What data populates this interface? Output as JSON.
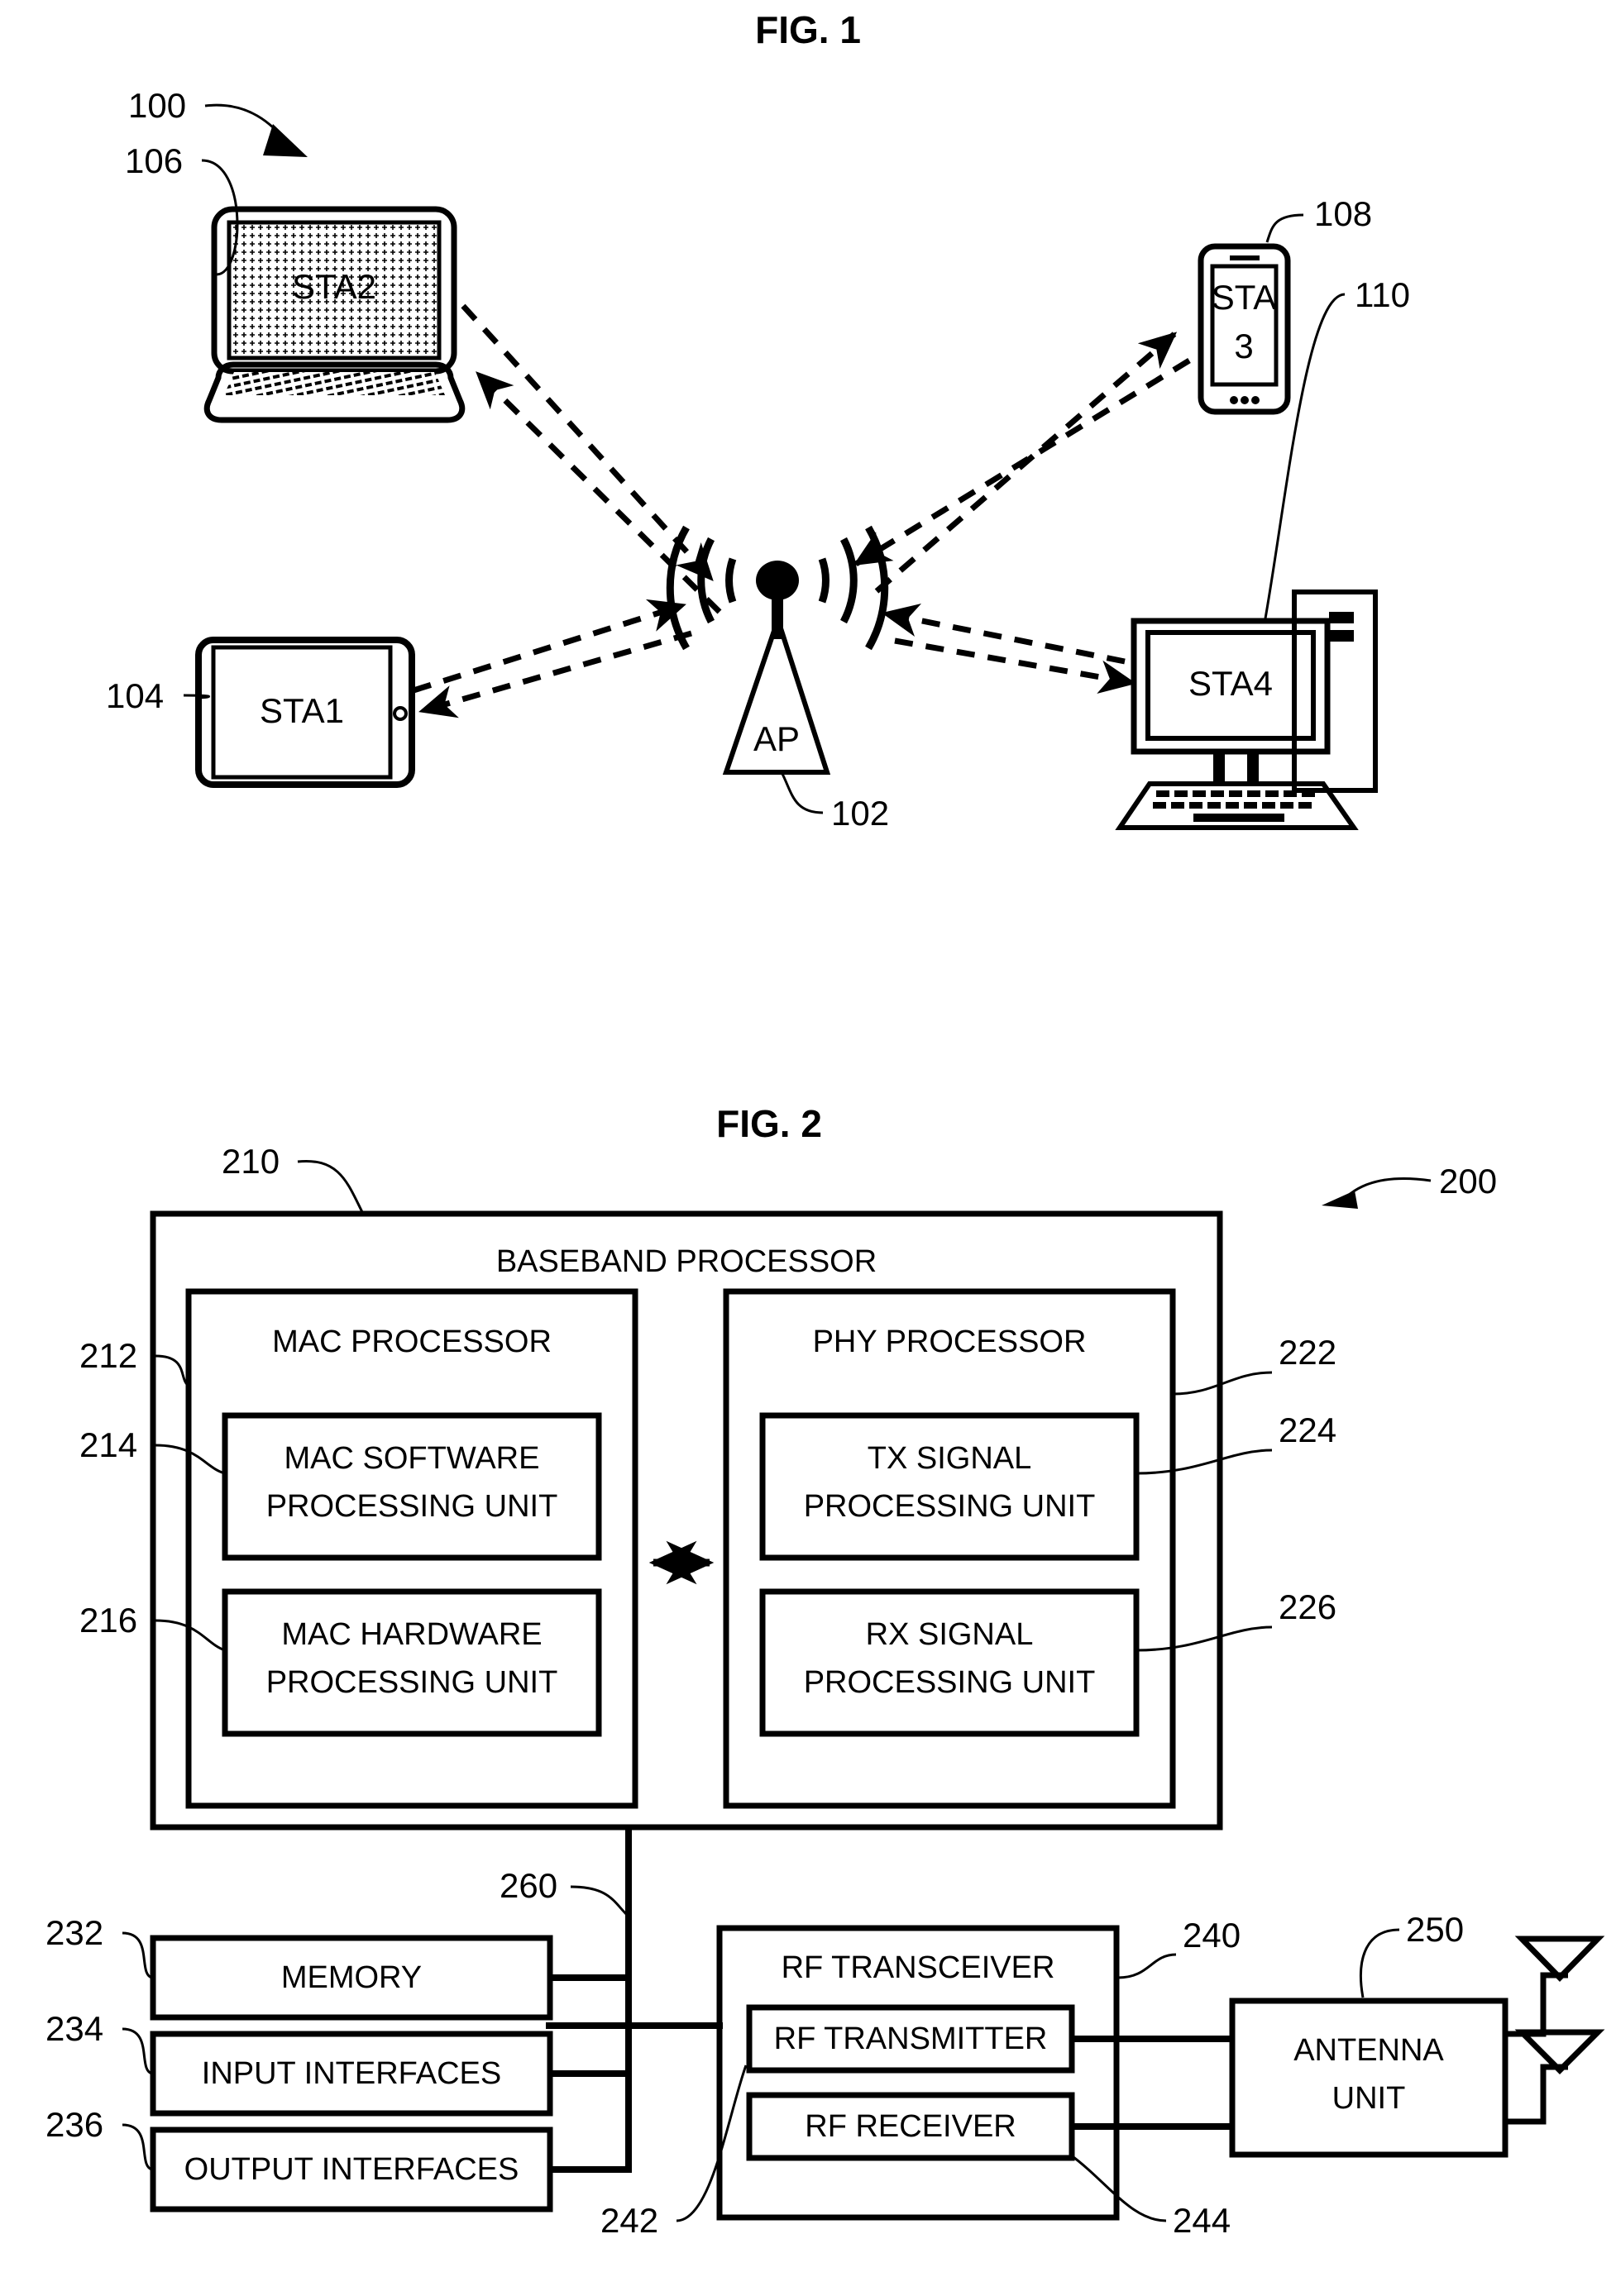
{
  "figures": [
    {
      "title": "FIG. 1",
      "system_ref": "100",
      "nodes": [
        {
          "ref": "106",
          "label": "STA2",
          "device": "laptop"
        },
        {
          "ref": "108",
          "label_line1": "STA",
          "label_line2": "3",
          "device": "smartphone"
        },
        {
          "ref": "104",
          "label": "STA1",
          "device": "tablet"
        },
        {
          "ref": "110",
          "label": "STA4",
          "device": "desktop-computer"
        },
        {
          "ref": "102",
          "label": "AP",
          "device": "access-point"
        }
      ]
    },
    {
      "title": "FIG. 2",
      "system_ref": "200",
      "baseband": {
        "ref": "210",
        "label": "BASEBAND PROCESSOR",
        "mac": {
          "ref": "212",
          "label": "MAC PROCESSOR",
          "units": [
            {
              "ref": "214",
              "line1": "MAC SOFTWARE",
              "line2": "PROCESSING UNIT"
            },
            {
              "ref": "216",
              "line1": "MAC HARDWARE",
              "line2": "PROCESSING UNIT"
            }
          ]
        },
        "phy": {
          "ref": "222",
          "label": "PHY PROCESSOR",
          "units": [
            {
              "ref": "224",
              "line1": "TX SIGNAL",
              "line2": "PROCESSING UNIT"
            },
            {
              "ref": "226",
              "line1": "RX SIGNAL",
              "line2": "PROCESSING UNIT"
            }
          ]
        }
      },
      "bus": {
        "ref": "260"
      },
      "peripherals": [
        {
          "ref": "232",
          "label": "MEMORY"
        },
        {
          "ref": "234",
          "label": "INPUT INTERFACES"
        },
        {
          "ref": "236",
          "label": "OUTPUT INTERFACES"
        }
      ],
      "transceiver": {
        "ref": "240",
        "label": "RF TRANSCEIVER",
        "units": [
          {
            "ref": "242",
            "label": "RF TRANSMITTER"
          },
          {
            "ref": "244",
            "label": "RF RECEIVER"
          }
        ]
      },
      "antenna": {
        "ref": "250",
        "line1": "ANTENNA",
        "line2": "UNIT",
        "count": 2
      }
    }
  ],
  "colors": {
    "ink": "#000000",
    "paper": "#ffffff"
  }
}
